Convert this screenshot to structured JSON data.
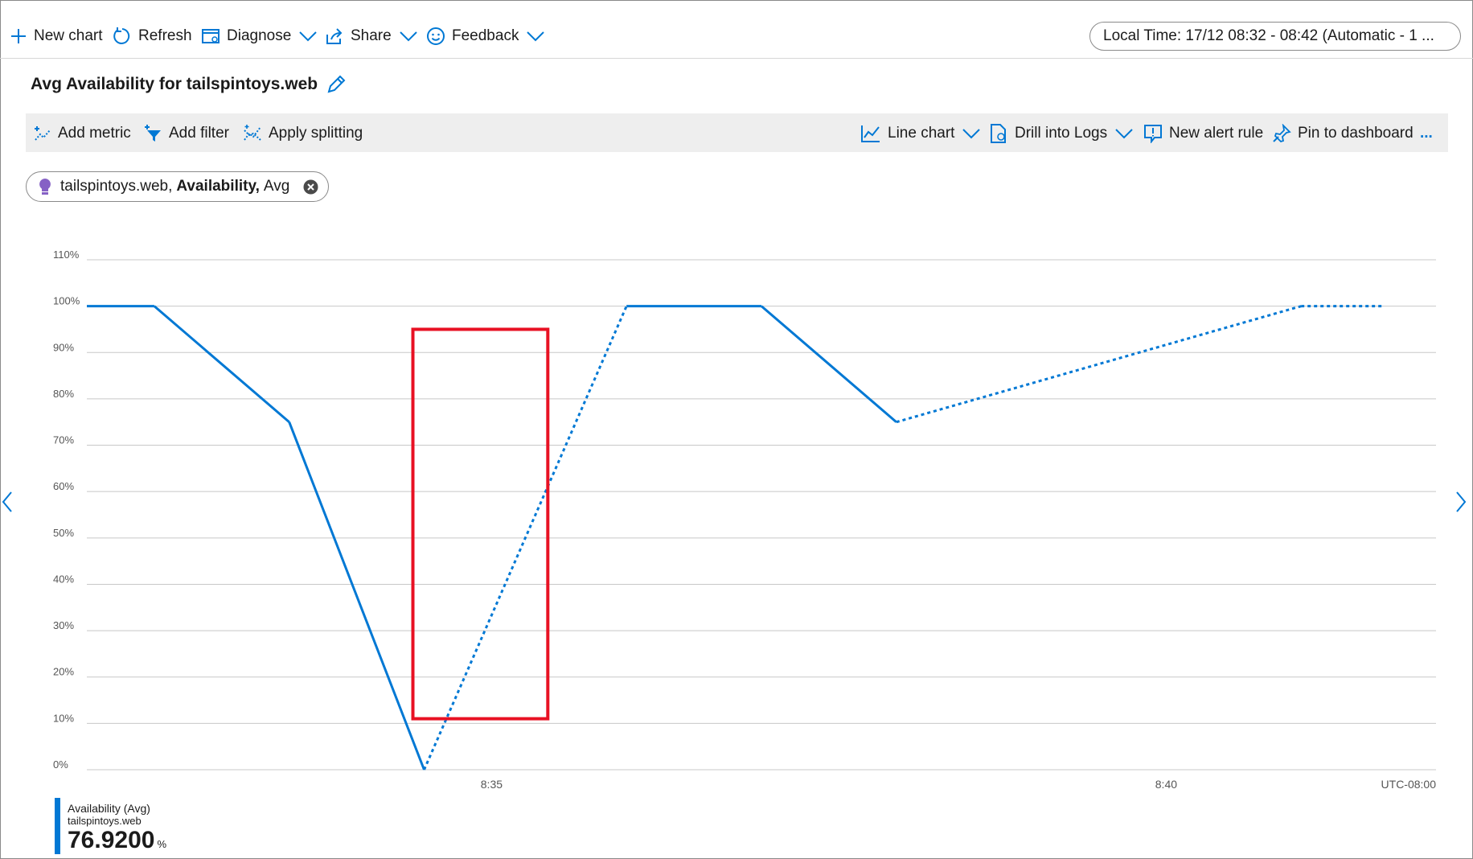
{
  "toolbar": {
    "new_chart": "New chart",
    "refresh": "Refresh",
    "diagnose": "Diagnose",
    "share": "Share",
    "feedback": "Feedback",
    "time_range": "Local Time: 17/12 08:32 - 08:42 (Automatic - 1 ..."
  },
  "chart_title": "Avg Availability for tailspintoys.web",
  "chart_toolbar": {
    "add_metric": "Add metric",
    "add_filter": "Add filter",
    "apply_splitting": "Apply splitting",
    "line_chart": "Line chart",
    "drill_into_logs": "Drill into Logs",
    "new_alert_rule": "New alert rule",
    "pin_to_dashboard": "Pin to dashboard",
    "more": "..."
  },
  "metric_pill": {
    "resource": "tailspintoys.web,",
    "metric": "Availability,",
    "aggregation": "Avg"
  },
  "legend": {
    "name": "Availability (Avg)",
    "resource": "tailspintoys.web",
    "value": "76.9200",
    "unit": "%"
  },
  "colors": {
    "series": "#0078d4",
    "highlight": "#e81123",
    "grid": "#c8c8c8"
  },
  "chart_data": {
    "type": "line",
    "title": "Avg Availability for tailspintoys.web",
    "ylim": [
      0,
      110
    ],
    "y_ticks": [
      "0%",
      "10%",
      "20%",
      "30%",
      "40%",
      "50%",
      "60%",
      "70%",
      "80%",
      "90%",
      "100%",
      "110%"
    ],
    "x_range": [
      "8:32",
      "8:42"
    ],
    "x_ticks": [
      "8:35",
      "8:40"
    ],
    "timezone_label": "UTC-08:00",
    "grid": true,
    "series": [
      {
        "name": "Availability (Avg)",
        "points": [
          {
            "x": "8:32",
            "y": 100,
            "style": "solid"
          },
          {
            "x": "8:32:30",
            "y": 100,
            "style": "solid"
          },
          {
            "x": "8:33:30",
            "y": 75,
            "style": "solid"
          },
          {
            "x": "8:34:30",
            "y": 0,
            "style": "dotted"
          },
          {
            "x": "8:36",
            "y": 100,
            "style": "solid"
          },
          {
            "x": "8:37",
            "y": 100,
            "style": "solid"
          },
          {
            "x": "8:38",
            "y": 75,
            "style": "dotted"
          },
          {
            "x": "8:41",
            "y": 100,
            "style": "dotted"
          },
          {
            "x": "8:41:36",
            "y": 100,
            "style": "end"
          }
        ]
      }
    ],
    "highlight_box": {
      "x_from": "8:34:25",
      "x_to": "8:35:25",
      "y_from": 11,
      "y_to": 95
    }
  }
}
